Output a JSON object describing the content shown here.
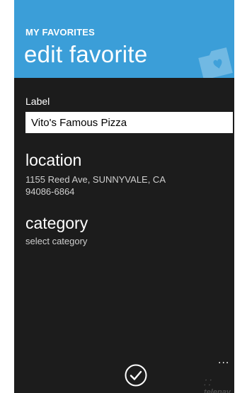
{
  "header": {
    "app_title": "MY FAVORITES",
    "page_title": "edit favorite",
    "accent_color": "#3b9ed8"
  },
  "form": {
    "label_caption": "Label",
    "label_value": "Vito's Famous Pizza"
  },
  "location": {
    "title": "location",
    "address_line1": "1155 Reed Ave, SUNNYVALE, CA",
    "address_line2": "94086-6864"
  },
  "category": {
    "title": "category",
    "value": "select category"
  },
  "app_bar": {
    "more_label": "...",
    "icons": [
      "check-circle-icon",
      "folder-heart-icon"
    ]
  },
  "branding": {
    "logo_text": "telenav"
  }
}
